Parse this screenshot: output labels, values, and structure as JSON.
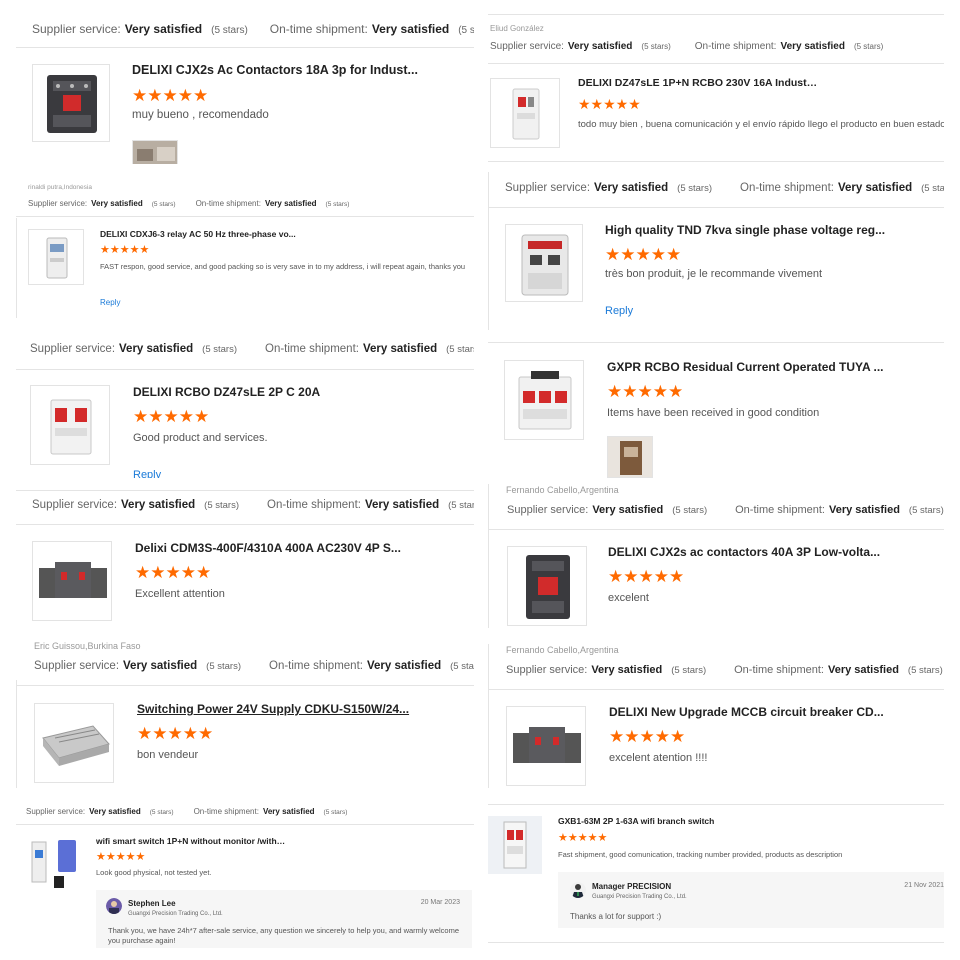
{
  "labels": {
    "supplier": "Supplier service:",
    "shipment": "On-time shipment:",
    "value": "Very satisfied",
    "stars_note": "(5 stars)",
    "reply": "Reply",
    "rating_stars": "★★★★★"
  },
  "icons": {
    "star": "star-icon",
    "product": "product-thumbnail"
  },
  "colors": {
    "star": "#ff6a00",
    "link": "#1a7ad8",
    "divider": "#e4e4e4",
    "seller_bg": "#f6f6f6"
  },
  "reviews": [
    {
      "product": "DELIXI CJX2s Ac Contactors 18A 3p for Indust...",
      "comment": "muy bueno , recomendado"
    },
    {
      "author": "Eliud González",
      "product": "DELIXI DZ47sLE 1P+N RCBO 230V 16A Industri...",
      "comment": "todo muy bien , buena comunicación y el envío rápido llego el producto en buen estado"
    },
    {
      "author": "rinaldi putra,Indonesia",
      "product": "DELIXI CDXJ6-3 relay AC 50 Hz three-phase vo...",
      "comment": "FAST respon, good service, and good packing so is very save in to my address,  i will repeat again, thanks you"
    },
    {
      "product": "High quality TND 7kva single phase voltage reg...",
      "comment": "très bon produit, je le recommande vivement"
    },
    {
      "product": "DELIXI RCBO DZ47sLE 2P C 20A",
      "comment": "Good product and services."
    },
    {
      "product": "GXPR RCBO Residual Current Operated TUYA ...",
      "comment": "Items have been received in good condition"
    },
    {
      "product": "Delixi CDM3S-400F/4310A 400A AC230V 4P S...",
      "comment": "Excellent attention"
    },
    {
      "author": "Fernando Cabello,Argentina",
      "product": "DELIXI CJX2s ac contactors 40A 3P Low-volta...",
      "comment": "excelent"
    },
    {
      "author": "Eric Guissou,Burkina Faso",
      "product": "Switching Power 24V Supply CDKU-S150W/24...",
      "comment": "bon vendeur"
    },
    {
      "author": "Fernando Cabello,Argentina",
      "product": "DELIXI New Upgrade MCCB circuit breaker CD...",
      "comment": "excelent atention !!!!"
    },
    {
      "product": "wifi smart switch 1P+N without monitor /with ...",
      "comment": "Look good physical, not tested yet.",
      "seller": {
        "name": "Stephen Lee",
        "company": "Guangxi Precision Trading Co., Ltd.",
        "date": "20 Mar 2023",
        "text": "Thank you, we have 24h*7 after-sale service, any question we sincerely to help you,  and warmly welcome you purchase again!"
      }
    },
    {
      "product": "GXB1-63M 2P 1-63A wifi branch switch",
      "comment": "Fast shipment, good comunication, tracking number provided, products as description",
      "seller": {
        "name": "Manager PRECISION",
        "company": "Guangxi Precision Trading Co., Ltd.",
        "date": "21 Nov 2021",
        "text": "Thanks a lot for support :)"
      }
    }
  ]
}
